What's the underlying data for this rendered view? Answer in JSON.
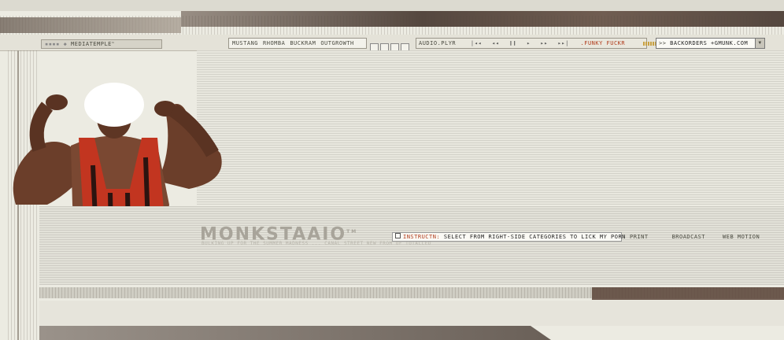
{
  "header": {
    "logo": "MEDIATEMPLE",
    "nav": [
      "MUSTANG",
      "RHOMBA",
      "BUCKRAM",
      "OUTGROWTH"
    ],
    "player_label": "AUDIO.PLYR",
    "track_title": ".FUNKY FUCKR",
    "dropdown": {
      "prefix": ">>",
      "value": "BACKORDERS +GMUNK.COM"
    }
  },
  "main": {
    "brand": "MONKSTAAIO",
    "brand_sup": "TM",
    "tagline": "BULKING UP FOR THE SUMMER MADNESS ... CANAL STREET NEW FROM OF TOTALLED",
    "instruction_label": "INSTRUCTN:",
    "instruction_text": "SELECT FROM RIGHT-SIDE CATEGORIES TO LICK MY PORN",
    "links": [
      "PRINT",
      "BROADCAST",
      "WEB MOTION"
    ]
  },
  "colors": {
    "background": "#ecebe2",
    "dark_brown": "#5a4438",
    "accent_red": "#b03a1a",
    "gray_text": "#4a4a40"
  }
}
